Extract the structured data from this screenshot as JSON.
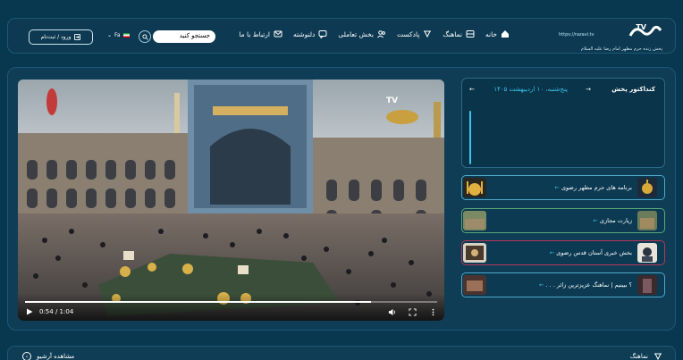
{
  "header": {
    "logo_url": "https://razavi.tv",
    "logo_tagline": "پخش زنده حرم مطهر امام رضا علیه السلام",
    "nav": [
      {
        "label": "خانه",
        "icon": "home-icon"
      },
      {
        "label": "نماهنگ",
        "icon": "film-icon"
      },
      {
        "label": "پادکست",
        "icon": "podcast-icon"
      },
      {
        "label": "بخش تعاملی",
        "icon": "users-icon"
      },
      {
        "label": "دلنوشته",
        "icon": "chat-icon"
      },
      {
        "label": "ارتباط با ما",
        "icon": "mail-icon"
      }
    ],
    "search": {
      "placeholder": "جستجو کنید"
    },
    "language": "Fa",
    "login_label": "ورود / ثبت‌نام"
  },
  "player": {
    "current_time": "0:54",
    "duration": "1:04",
    "progress_percent": 84,
    "watermark": "TV"
  },
  "conductor": {
    "title": "کنداکتور پخش",
    "date": "پنج‌شنبه، ۱۰ اردیبهشت ۱۴۰۵",
    "next": "→",
    "prev": "←"
  },
  "programs": [
    {
      "label": "برنامه های حرم مطهر رضوی",
      "arrow": "←",
      "border": "#4fa8c8"
    },
    {
      "label": "زیارت مجازی",
      "arrow": "←",
      "border": "#5aa878"
    },
    {
      "label": "بخش خبری آستان قدس رضوی",
      "arrow": "←",
      "border": "#b8365a"
    },
    {
      "label": "؟ ببینیم | نماهنگ عزیزترین زائر . . .",
      "arrow": "←",
      "border": "#4fa8c8"
    }
  ],
  "archive": {
    "left_label": "مشاهده آرشیو",
    "right_label": "نماهنگ"
  },
  "colors": {
    "background": "#08384f",
    "accent": "#3fc4ee"
  }
}
